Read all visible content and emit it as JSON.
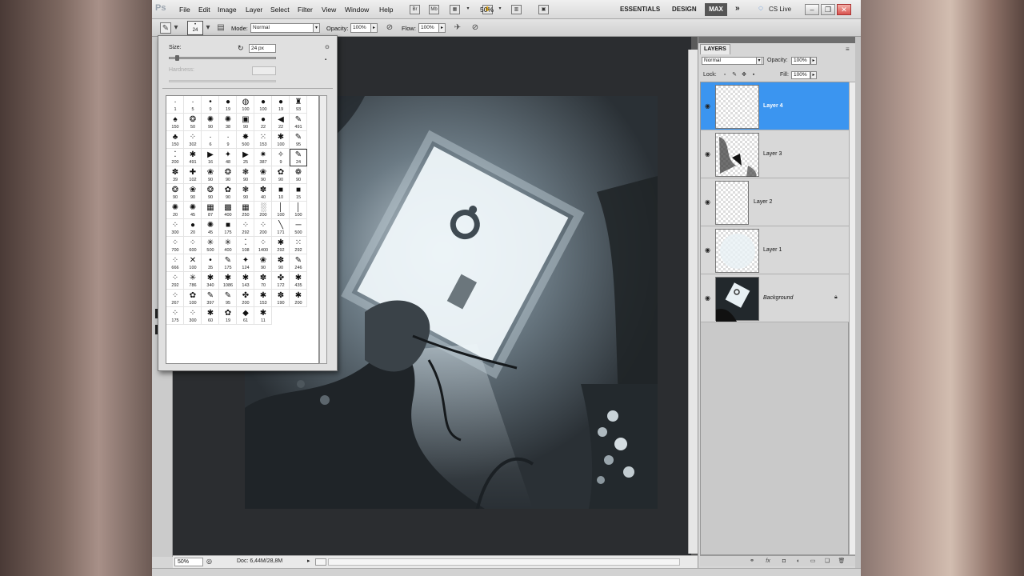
{
  "app": {
    "logo": "Ps"
  },
  "menu": [
    "File",
    "Edit",
    "Image",
    "Layer",
    "Select",
    "Filter",
    "View",
    "Window",
    "Help"
  ],
  "menubar": {
    "bridge_icon": "Br",
    "minibridge_icon": "Mb",
    "zoom": "50%",
    "workspaces": [
      "ESSENTIALS",
      "DESIGN"
    ],
    "active_workspace": "MAX",
    "more": "»",
    "cslive": "CS Live",
    "window_buttons": [
      "minimize",
      "restore",
      "close"
    ]
  },
  "options": {
    "brush_size_value": "24",
    "mode_label": "Mode:",
    "mode_value": "Normal",
    "opacity_label": "Opacity:",
    "opacity_value": "100%",
    "flow_label": "Flow:",
    "flow_value": "100%"
  },
  "brush_picker": {
    "size_label": "Size:",
    "size_value": "24 px",
    "size_fraction": 0.05,
    "hardness_label": "Hardness:",
    "hardness_value": "",
    "menu_icon": "play-icon",
    "rows": [
      [
        "1",
        "5",
        "9",
        "19",
        "100",
        "100",
        "19",
        "93",
        "",
        ""
      ],
      [
        "150",
        "50",
        "90",
        "38",
        "90",
        "22",
        "22",
        "491",
        "",
        ""
      ],
      [
        "150",
        "302",
        "6",
        "9",
        "500",
        "153",
        "100",
        "95",
        "",
        ""
      ],
      [
        "200",
        "491",
        "16",
        "48",
        "25",
        "387",
        "9",
        "24",
        "",
        ""
      ],
      [
        "39",
        "102",
        "90",
        "90",
        "90",
        "90",
        "90",
        "90",
        "",
        ""
      ],
      [
        "90",
        "90",
        "90",
        "90",
        "90",
        "40",
        "10",
        "15",
        "",
        ""
      ],
      [
        "20",
        "45",
        "87",
        "400",
        "250",
        "200",
        "100",
        "100",
        "",
        ""
      ],
      [
        "300",
        "20",
        "45",
        "175",
        "292",
        "200",
        "171",
        "500",
        "",
        ""
      ],
      [
        "700",
        "600",
        "500",
        "400",
        "108",
        "1400",
        "292",
        "292",
        "",
        ""
      ],
      [
        "666",
        "100",
        "35",
        "175",
        "124",
        "90",
        "90",
        "246",
        "",
        ""
      ],
      [
        "292",
        "786",
        "340",
        "1086",
        "143",
        "70",
        "172",
        "435",
        "",
        ""
      ],
      [
        "267",
        "100",
        "397",
        "95",
        "200",
        "153",
        "190",
        "200",
        "",
        ""
      ],
      [
        "175",
        "300",
        "60",
        "19",
        "61",
        "11",
        "",
        "",
        "",
        ""
      ]
    ],
    "glyphs": [
      [
        "·",
        "·",
        "•",
        "●",
        "◍",
        "●",
        "●",
        "♜"
      ],
      [
        "♠",
        "❂",
        "✺",
        "✺",
        "▣",
        "●",
        "◀",
        "✎"
      ],
      [
        "♣",
        "⁘",
        "·",
        "∙",
        "✸",
        "⁙",
        "✱",
        "✎"
      ],
      [
        "⁚",
        "✱",
        "▶",
        "✦",
        "▶",
        "✷",
        "✧",
        "✎"
      ],
      [
        "✽",
        "✚",
        "❀",
        "❂",
        "❃",
        "❀",
        "✿",
        "❁"
      ],
      [
        "❂",
        "❀",
        "❂",
        "✿",
        "❃",
        "✽",
        "■",
        "■"
      ],
      [
        "✺",
        "✺",
        "▦",
        "▩",
        "▦",
        "░",
        "│",
        "│"
      ],
      [
        "⁘",
        "●",
        "✺",
        "■",
        "⁘",
        "⁘",
        "╲",
        "─"
      ],
      [
        "⁘",
        "⁘",
        "✳",
        "✳",
        "⁚",
        "⁘",
        "✱",
        "⁙"
      ],
      [
        "⁘",
        "✕",
        "•",
        "✎",
        "✦",
        "❀",
        "✽",
        "✎"
      ],
      [
        "⁘",
        "✳",
        "✱",
        "✱",
        "✱",
        "✽",
        "✤",
        "✱"
      ],
      [
        "⁘",
        "✿",
        "✎",
        "✎",
        "✤",
        "✱",
        "✽",
        "✱"
      ],
      [
        "⁘",
        "⁘",
        "✱",
        "✿",
        "◆",
        "✱",
        "",
        ""
      ]
    ],
    "selected_index": [
      3,
      7
    ]
  },
  "layers_panel": {
    "tab": "LAYERS",
    "blend_mode": "Normal",
    "opacity_label": "Opacity:",
    "opacity_value": "100%",
    "lock_label": "Lock:",
    "fill_label": "Fill:",
    "fill_value": "100%",
    "layers": [
      {
        "name": "Layer 4",
        "active": true
      },
      {
        "name": "Layer 3",
        "active": false
      },
      {
        "name": "Layer 2",
        "active": false
      },
      {
        "name": "Layer 1",
        "active": false
      },
      {
        "name": "Background",
        "active": false,
        "locked": true
      }
    ]
  },
  "status": {
    "zoom": "50%",
    "doc": "Doc: 6,44M/28,8M"
  },
  "colors": {
    "selection": "#3b95f0",
    "canvas_bg": "#2b2d30"
  }
}
